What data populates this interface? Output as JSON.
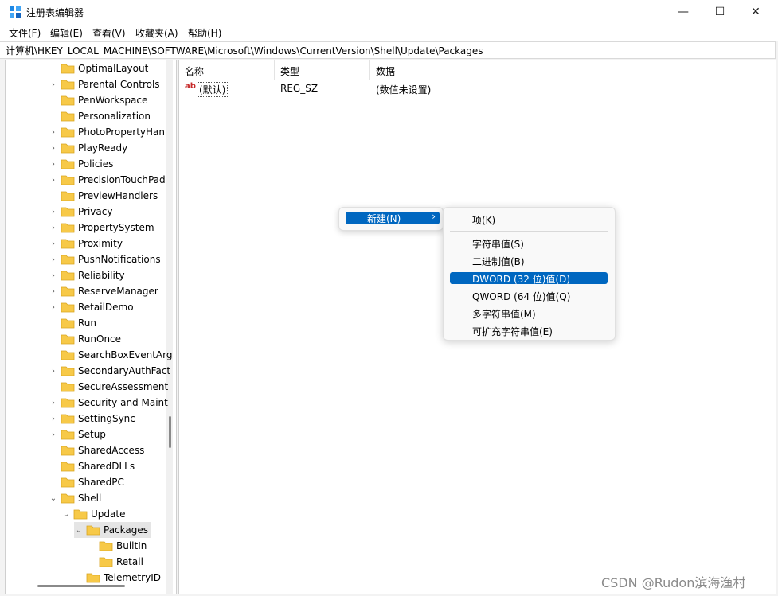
{
  "window": {
    "title": "注册表编辑器",
    "controls": [
      "—",
      "☐",
      "✕"
    ]
  },
  "menu": [
    "文件(F)",
    "编辑(E)",
    "查看(V)",
    "收藏夹(A)",
    "帮助(H)"
  ],
  "address": "计算机\\HKEY_LOCAL_MACHINE\\SOFTWARE\\Microsoft\\Windows\\CurrentVersion\\Shell\\Update\\Packages",
  "tree": {
    "items": [
      {
        "label": "OptimalLayout",
        "chev": ""
      },
      {
        "label": "Parental Controls",
        "chev": "›"
      },
      {
        "label": "PenWorkspace",
        "chev": ""
      },
      {
        "label": "Personalization",
        "chev": ""
      },
      {
        "label": "PhotoPropertyHan",
        "chev": "›"
      },
      {
        "label": "PlayReady",
        "chev": "›"
      },
      {
        "label": "Policies",
        "chev": "›"
      },
      {
        "label": "PrecisionTouchPad",
        "chev": "›"
      },
      {
        "label": "PreviewHandlers",
        "chev": ""
      },
      {
        "label": "Privacy",
        "chev": "›"
      },
      {
        "label": "PropertySystem",
        "chev": "›"
      },
      {
        "label": "Proximity",
        "chev": "›"
      },
      {
        "label": "PushNotifications",
        "chev": "›"
      },
      {
        "label": "Reliability",
        "chev": "›"
      },
      {
        "label": "ReserveManager",
        "chev": "›"
      },
      {
        "label": "RetailDemo",
        "chev": "›"
      },
      {
        "label": "Run",
        "chev": ""
      },
      {
        "label": "RunOnce",
        "chev": ""
      },
      {
        "label": "SearchBoxEventArg",
        "chev": ""
      },
      {
        "label": "SecondaryAuthFact",
        "chev": "›"
      },
      {
        "label": "SecureAssessment",
        "chev": ""
      },
      {
        "label": "Security and Maint",
        "chev": "›"
      },
      {
        "label": "SettingSync",
        "chev": "›"
      },
      {
        "label": "Setup",
        "chev": "›"
      },
      {
        "label": "SharedAccess",
        "chev": ""
      },
      {
        "label": "SharedDLLs",
        "chev": ""
      },
      {
        "label": "SharedPC",
        "chev": ""
      },
      {
        "label": "Shell",
        "chev": "⌄"
      },
      {
        "label": "Update",
        "chev": "⌄"
      },
      {
        "label": "Packages",
        "chev": "⌄"
      },
      {
        "label": "BuiltIn",
        "chev": ""
      },
      {
        "label": "Retail",
        "chev": ""
      },
      {
        "label": "TelemetryID",
        "chev": ""
      }
    ]
  },
  "columns": [
    "名称",
    "类型",
    "数据"
  ],
  "values": [
    {
      "name": "(默认)",
      "type": "REG_SZ",
      "data": "(数值未设置)",
      "icon": "ab"
    }
  ],
  "context_menu": {
    "new_label": "新建(N)",
    "new_arrow": "›",
    "items": [
      "项(K)",
      "字符串值(S)",
      "二进制值(B)",
      "DWORD (32 位)值(D)",
      "QWORD (64 位)值(Q)",
      "多字符串值(M)",
      "可扩充字符串值(E)"
    ],
    "highlighted": "DWORD (32 位)值(D)"
  },
  "watermark": "CSDN @Rudon滨海渔村",
  "colors": {
    "accent": "#0067c0",
    "folder": "#f7c948"
  }
}
